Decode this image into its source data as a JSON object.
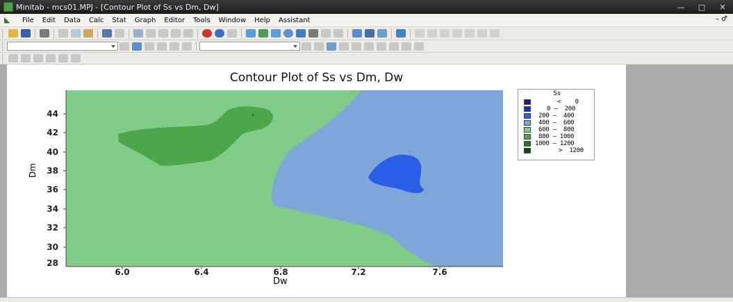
{
  "window": {
    "title": "Minitab - mcs01.MPJ - [Contour Plot of Ss vs Dm, Dw]",
    "controls": [
      "—",
      "□",
      "✕"
    ]
  },
  "menubar": {
    "items": [
      "File",
      "Edit",
      "Data",
      "Calc",
      "Stat",
      "Graph",
      "Editor",
      "Tools",
      "Window",
      "Help",
      "Assistant"
    ],
    "right_controls": "– ♂"
  },
  "chart": {
    "title": "Contour Plot of Ss vs Dm, Dw",
    "xlabel": "Dw",
    "ylabel": "Dm",
    "x_ticks": [
      "6.0",
      "6.4",
      "6.8",
      "7.2",
      "7.6"
    ],
    "y_ticks": [
      "44",
      "42",
      "40",
      "38",
      "36",
      "34",
      "32",
      "30",
      "28"
    ]
  },
  "chart_data": {
    "type": "heatmap",
    "subtype": "contour",
    "title": "Contour Plot of Ss vs Dm, Dw",
    "xlabel": "Dw",
    "ylabel": "Dm",
    "x_ticks": [
      6.0,
      6.4,
      6.8,
      7.2,
      7.6
    ],
    "y_ticks": [
      28,
      30,
      32,
      34,
      36,
      38,
      40,
      42,
      44
    ],
    "xlim": [
      5.8,
      7.8
    ],
    "ylim": [
      26.1,
      44.8
    ],
    "legend": {
      "title": "Ss",
      "position": "right",
      "entries": [
        {
          "label": "<    0",
          "color": "#1a1d80"
        },
        {
          "label": "0 –  200",
          "color": "#1e28c6"
        },
        {
          "label": "200 –  400",
          "color": "#2a5ee6"
        },
        {
          "label": "400 –  600",
          "color": "#7ea6d8"
        },
        {
          "label": "600 –  800",
          "color": "#82cc8a"
        },
        {
          "label": "800 – 1000",
          "color": "#4da64a"
        },
        {
          "label": "1000 – 1200",
          "color": "#1e7a24"
        },
        {
          "label": ">  1200",
          "color": "#0a4d0e"
        }
      ]
    },
    "regions": [
      {
        "band": "600 – 800",
        "color": "#82cc8a",
        "description": "left side of plot"
      },
      {
        "band": "400 – 600",
        "color": "#7ea6d8",
        "description": "right side of plot"
      },
      {
        "band": "800 – 1000",
        "color": "#4da64a",
        "description": "island near Dw 6.0–6.7, Dm 37–43"
      },
      {
        "band": "200 – 400",
        "color": "#2a5ee6",
        "description": "island near Dw 7.1–7.4, Dm 34–38"
      }
    ]
  }
}
